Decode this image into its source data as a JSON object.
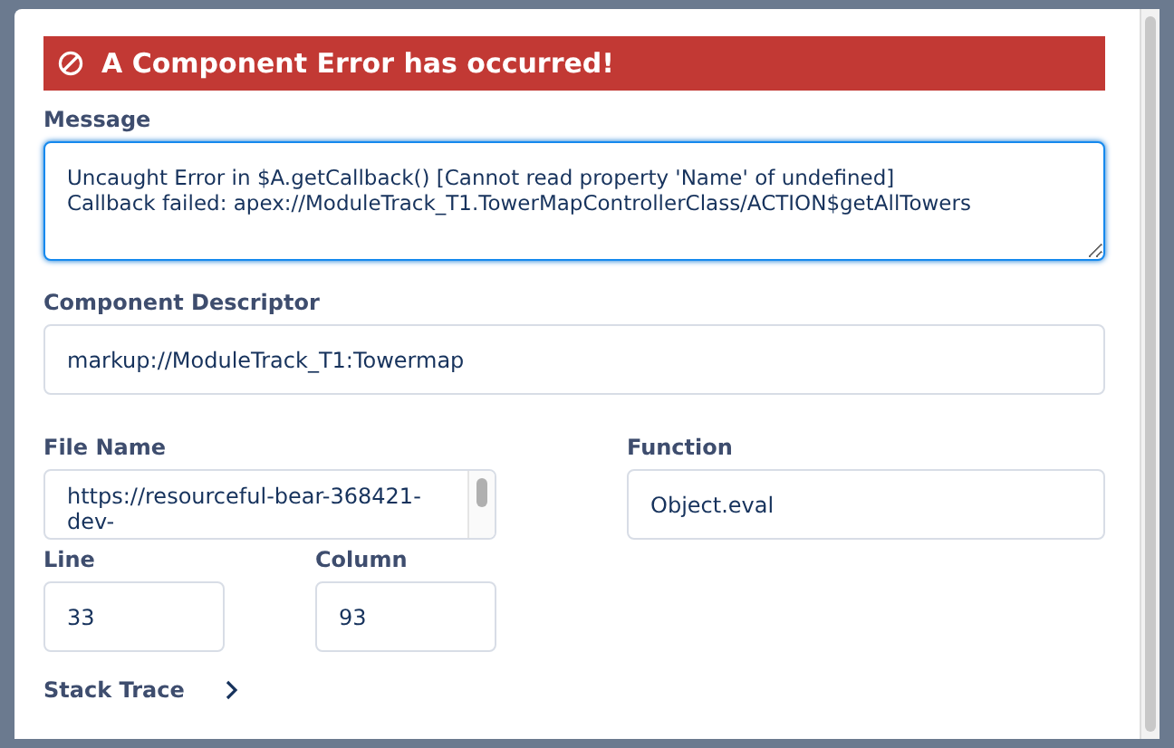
{
  "banner": {
    "title": "A Component Error has occurred!"
  },
  "message": {
    "label": "Message",
    "value": "Uncaught Error in $A.getCallback() [Cannot read property 'Name' of undefined]\nCallback failed: apex://ModuleTrack_T1.TowerMapControllerClass/ACTION$getAllTowers",
    "focused": true
  },
  "component_descriptor": {
    "label": "Component Descriptor",
    "value": "markup://ModuleTrack_T1:Towermap"
  },
  "file_name": {
    "label": "File Name",
    "value": "https://resourceful-bear-368421-dev-"
  },
  "function": {
    "label": "Function",
    "value": "Object.eval"
  },
  "line": {
    "label": "Line",
    "value": "33"
  },
  "column": {
    "label": "Column",
    "value": "93"
  },
  "stack_trace": {
    "label": "Stack Trace",
    "expanded": false
  }
}
